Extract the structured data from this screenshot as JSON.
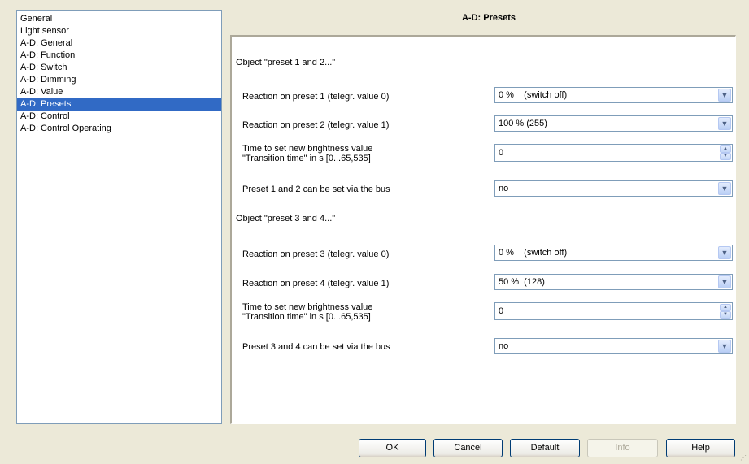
{
  "nav": {
    "items": [
      {
        "label": "General"
      },
      {
        "label": "Light sensor"
      },
      {
        "label": "A-D: General"
      },
      {
        "label": "A-D: Function"
      },
      {
        "label": "A-D: Switch"
      },
      {
        "label": "A-D: Dimming"
      },
      {
        "label": "A-D: Value"
      },
      {
        "label": "A-D: Presets"
      },
      {
        "label": "A-D: Control"
      },
      {
        "label": "A-D: Control Operating"
      }
    ],
    "selected_label": "A-D: Presets"
  },
  "page": {
    "title": "A-D: Presets"
  },
  "sections": [
    {
      "heading": "Object \"preset 1 and 2...\"",
      "params": [
        {
          "label": "Reaction on preset 1 (telegr. value 0)",
          "value": "0 %    (switch off)"
        },
        {
          "label": "Reaction on preset 2 (telegr. value 1)",
          "value": "100 % (255)"
        },
        {
          "label_line1": "Time to set new brightness value",
          "label_line2": "\"Transition time\" in s [0...65,535]",
          "value": "0"
        },
        {
          "label": "Preset 1 and 2 can be set via the bus",
          "value": "no"
        }
      ]
    },
    {
      "heading": "Object \"preset 3 and 4...\"",
      "params": [
        {
          "label": "Reaction on preset 3 (telegr. value 0)",
          "value": "0 %    (switch off)"
        },
        {
          "label": "Reaction on preset 4 (telegr. value 1)",
          "value": "50 %  (128)"
        },
        {
          "label_line1": "Time to set new brightness value",
          "label_line2": "\"Transition time\" in s [0...65,535]",
          "value": "0"
        },
        {
          "label": "Preset 3 and 4 can be set via the bus",
          "value": "no"
        }
      ]
    }
  ],
  "buttons": {
    "ok": "OK",
    "cancel": "Cancel",
    "default": "Default",
    "info": "Info",
    "help": "Help"
  },
  "icons": {
    "dropdown": "chevron-down-icon",
    "spin_up": "spin-up-icon",
    "spin_down": "spin-down-icon",
    "grip": "resize-grip-icon"
  },
  "colors": {
    "selection": "#316ac5",
    "window": "#ece9d8",
    "field_border": "#7f9db9"
  }
}
